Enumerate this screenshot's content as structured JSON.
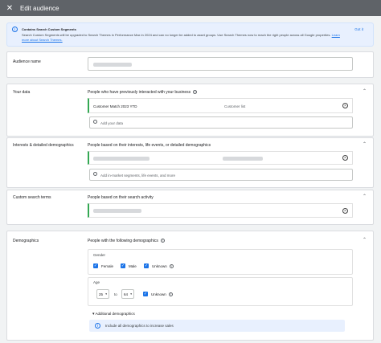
{
  "header": {
    "close_icon": "close-icon",
    "title": "Edit audience"
  },
  "banner": {
    "title": "Contains Search Custom Segments",
    "text": "Search Custom Segments will be upgraded to Search Themes in Performance Max in 2024 and can no longer be added to asset groups. Use Search Themes now to reach the right people across all Google properties.",
    "link": "Learn more about Search Themes.",
    "action": "Got it"
  },
  "audience_name": {
    "label": "Audience name"
  },
  "your_data": {
    "label": "Your data",
    "heading": "People who have previously interacted with your business",
    "segment_name": "Customer Match 2023 YTD",
    "segment_type": "Customer list",
    "search_placeholder": "Add your data"
  },
  "interests": {
    "label": "Interests & detailed demographics",
    "heading": "People based on their interests, life events, or detailed demographics",
    "search_placeholder": "Add in-market segments, life events, and more"
  },
  "custom_search": {
    "label": "Custom search terms",
    "heading": "People based on their search activity"
  },
  "demographics": {
    "label": "Demographics",
    "heading": "People with the following demographics",
    "gender_label": "Gender",
    "genders": [
      "Female",
      "Male",
      "Unknown"
    ],
    "age_label": "Age",
    "age_from": "25",
    "to_label": "to",
    "age_to": "64",
    "age_unknown": "Unknown",
    "additional_toggle": "Additional demographics",
    "include_all": "Include all demographics to increase sales"
  }
}
